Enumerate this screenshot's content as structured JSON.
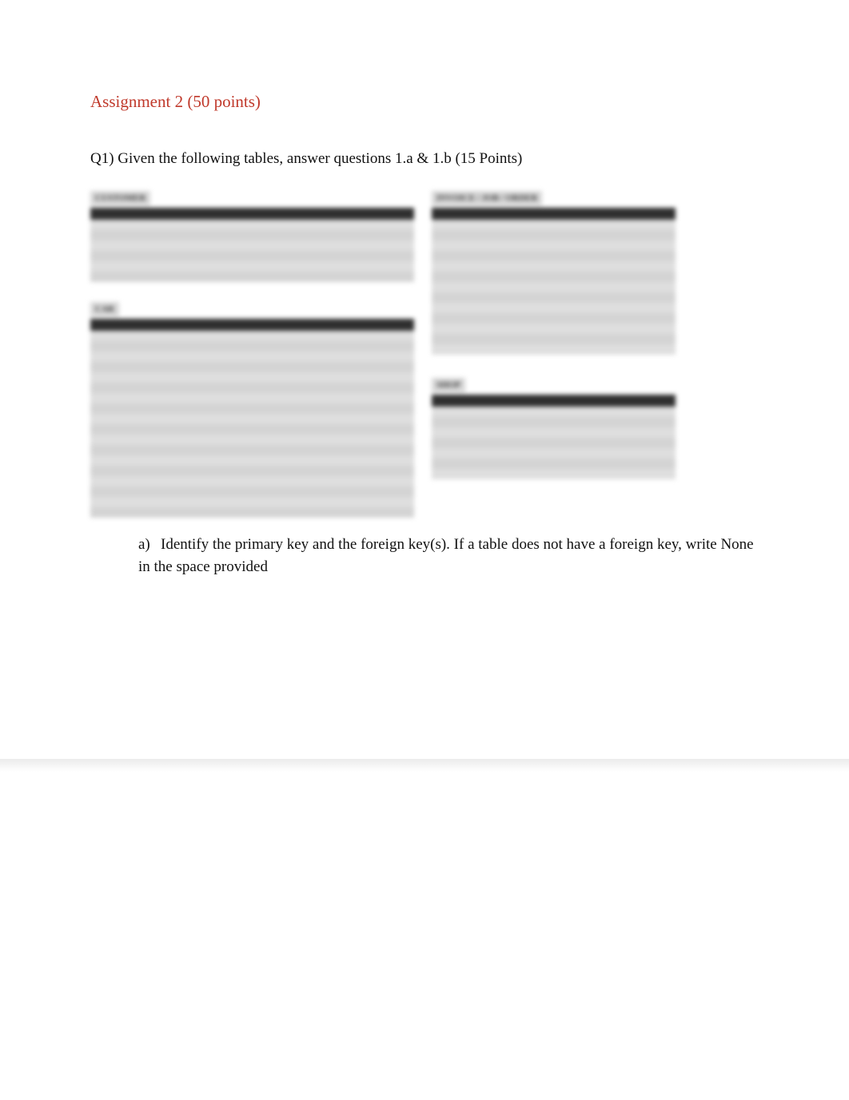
{
  "title": "Assignment 2 (50 points)",
  "q1_intro": "Q1) Given the following tables, answer questions 1.a & 1.b (15 Points)",
  "tables": {
    "customer": {
      "title": "CUSTOMER"
    },
    "car": {
      "title": "CAR"
    },
    "invoice": {
      "title": "INVOICE / JOB / ORDER"
    },
    "shop": {
      "title": "SHOP"
    }
  },
  "subq": {
    "a_marker": "a)",
    "a_text": "Identify the primary key and the foreign key(s). If a table does not have a foreign key, write None in the space provided"
  }
}
